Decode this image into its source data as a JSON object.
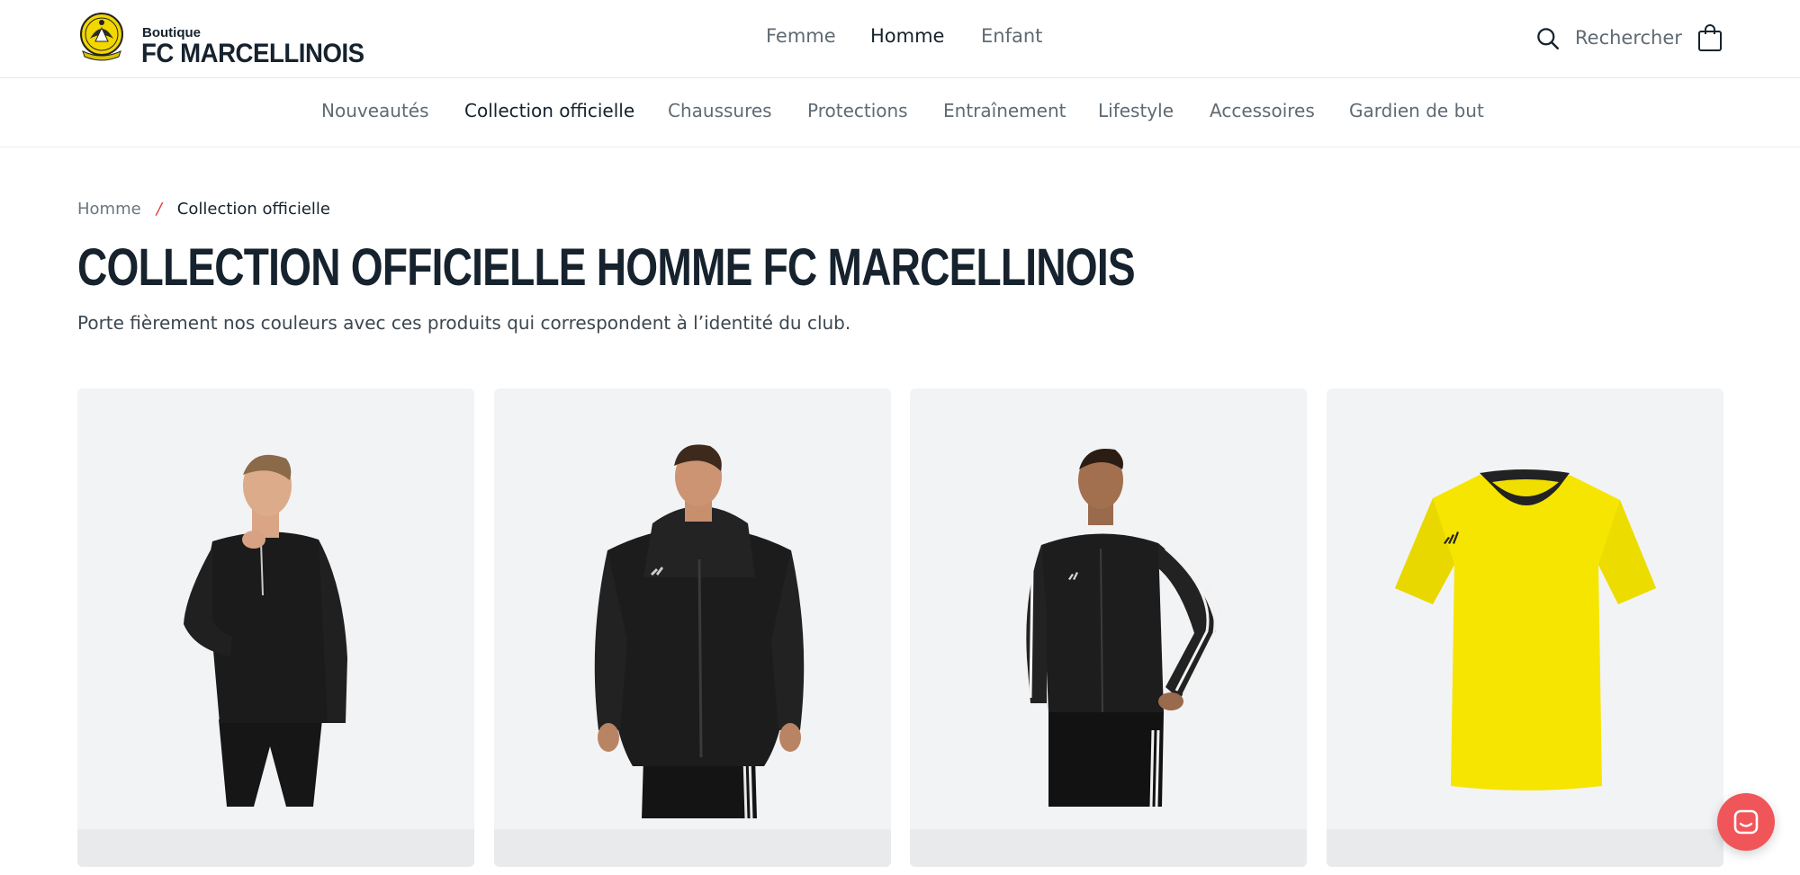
{
  "brand": {
    "small": "Boutique",
    "name": "FC MARCELLINOIS"
  },
  "gender_nav": [
    {
      "label": "Femme",
      "active": false
    },
    {
      "label": "Homme",
      "active": true
    },
    {
      "label": "Enfant",
      "active": false
    }
  ],
  "search": {
    "label": "Rechercher",
    "icon": "search-icon"
  },
  "cart": {
    "icon": "shopping-bag-icon"
  },
  "categories": [
    {
      "label": "Nouveautés",
      "active": false
    },
    {
      "label": "Collection officielle",
      "active": true
    },
    {
      "label": "Chaussures",
      "active": false
    },
    {
      "label": "Protections",
      "active": false
    },
    {
      "label": "Entraînement",
      "active": false
    },
    {
      "label": "Lifestyle",
      "active": false
    },
    {
      "label": "Accessoires",
      "active": false
    },
    {
      "label": "Gardien de but",
      "active": false
    }
  ],
  "breadcrumb": {
    "home": "Homme",
    "separator": "/",
    "current": "Collection officielle"
  },
  "page": {
    "title": "COLLECTION OFFICIELLE HOMME FC MARCELLINOIS",
    "description": "Porte fièrement nos couleurs avec ces produits qui correspondent à l’identité du club."
  },
  "products": [
    {
      "image": "black-half-zip-training-top"
    },
    {
      "image": "black-hooded-stadium-parka"
    },
    {
      "image": "black-track-jacket-white-stripes"
    },
    {
      "image": "yellow-jersey-black-v-collar"
    }
  ],
  "chat": {
    "icon": "chat-icon"
  },
  "colors": {
    "text": "#16222d",
    "muted": "#5f6a73",
    "accent_red": "#e23d3d",
    "card_bg": "#f2f3f5",
    "jersey_yellow": "#f6e500",
    "chat_button": "#f0555a"
  }
}
